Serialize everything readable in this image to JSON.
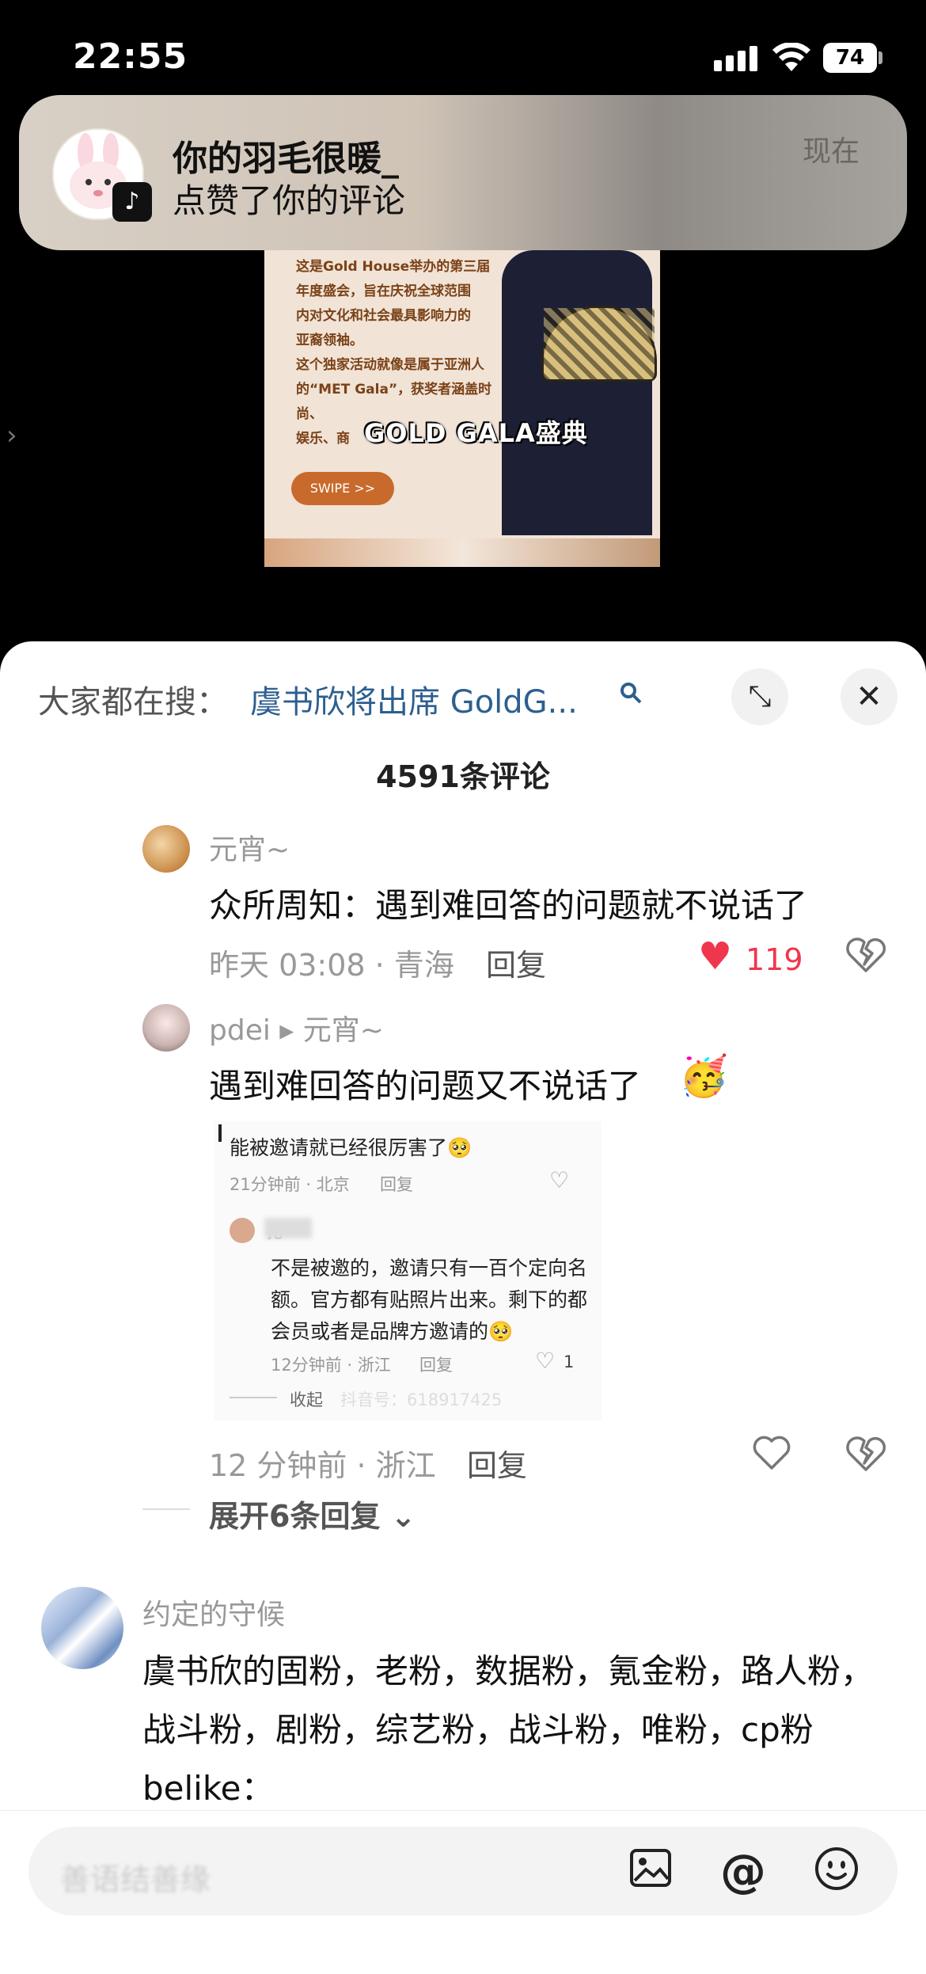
{
  "status_bar": {
    "time": "22:55",
    "battery": "74"
  },
  "notification": {
    "title": "你的羽毛很暖_",
    "body": "点赞了你的评论",
    "time": "现在",
    "app_icon": "tiktok-icon"
  },
  "video": {
    "text_lines": [
      "这是Gold House举办的第三届",
      "年度盛会，旨在庆祝全球范围",
      "内对文化和社会最具影响力的",
      "亚裔领袖。",
      "这个独家活动就像是属于亚洲人",
      "的“MET Gala”，获奖者涵盖时尚、",
      "娱乐、商"
    ],
    "caption": "GOLD GALA盛典",
    "swipe_label": "SWIPE >>"
  },
  "sheet": {
    "search_prefix": "大家都在搜：",
    "search_query": "虞书欣将出席 GoldG...",
    "comment_count": "4591条评论"
  },
  "comments": [
    {
      "user": "元宵~",
      "text": "众所周知：遇到难回答的问题就不说话了",
      "meta": "昨天 03:08 · 青海",
      "reply_label": "回复",
      "likes": "119"
    },
    {
      "user": "pdei ▸ 元宵~",
      "text": "遇到难回答的问题又不说话了",
      "emoji": "🥳",
      "embed": {
        "line1": "能被邀请就已经很厉害了🥺",
        "meta1": "21分钟前 · 北京",
        "reply1": "回复",
        "name2": "扎",
        "text2_l1": "不是被邀的，邀请只有一百个定向名",
        "text2_l2": "额。官方都有贴照片出来。剩下的都",
        "text2_l3": "会员或者是品牌方邀请的🥺",
        "meta2": "12分钟前 · 浙江",
        "reply2": "回复",
        "likes2": "1",
        "collapse": "收起",
        "watermark": "抖音号：618917425"
      },
      "meta": "12 分钟前 · 浙江",
      "reply_label": "回复"
    },
    {
      "user": "约定的守候",
      "text": "虞书欣的固粉，老粉，数据粉，氪金粉，路人粉，战斗粉，剧粉，综艺粉，战斗粉，唯粉，cp粉belike："
    }
  ],
  "expand_replies": "展开6条回复 ⌄",
  "input": {
    "placeholder": "善语结善缘"
  }
}
